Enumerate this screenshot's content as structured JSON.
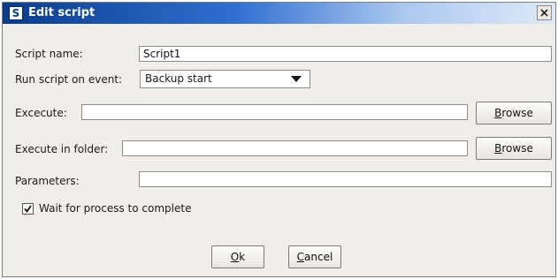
{
  "window": {
    "title": "Edit script",
    "app_icon_glyph": "S",
    "close_glyph": "×"
  },
  "form": {
    "script_name": {
      "label": "Script name:",
      "value": "Script1"
    },
    "run_on_event": {
      "label": "Run script on event:",
      "selected": "Backup start"
    },
    "execute": {
      "label": "Excecute:",
      "value": "",
      "browse_first": "B",
      "browse_rest": "rowse"
    },
    "execute_folder": {
      "label": "Execute in folder:",
      "value": "",
      "browse_first": "B",
      "browse_rest": "rowse"
    },
    "parameters": {
      "label": "Parameters:",
      "value": ""
    },
    "wait": {
      "label": "Wait for process to complete",
      "checked": true
    }
  },
  "buttons": {
    "ok": {
      "first": "O",
      "rest": "k"
    },
    "cancel": {
      "first": "C",
      "rest": "ancel"
    }
  },
  "colors": {
    "title_gradient_start": "#0b3c8c",
    "title_gradient_end": "#dfe9f7",
    "dialog_bg": "#f0eeea"
  },
  "icons": {
    "app": "app-icon",
    "close": "close-icon",
    "dropdown": "chevron-down-icon",
    "check": "checkmark-icon"
  }
}
